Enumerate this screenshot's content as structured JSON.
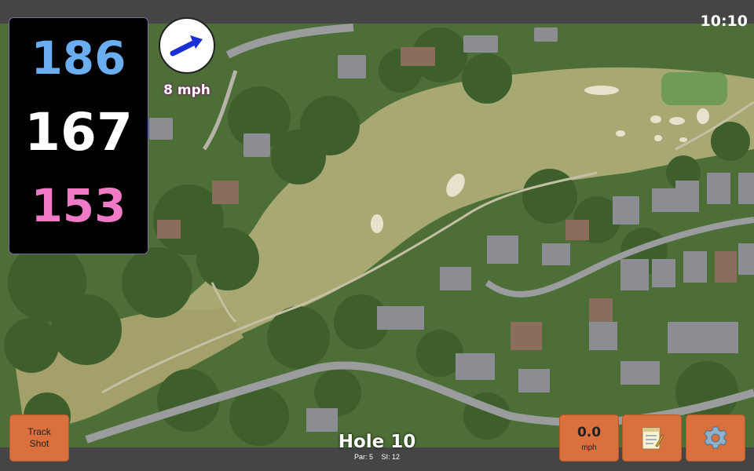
{
  "status_bar": {
    "time": "10:10"
  },
  "distances": {
    "back": "186",
    "center": "167",
    "front": "153"
  },
  "wind": {
    "speed_label": "8 mph",
    "direction_icon": "arrow-icon"
  },
  "hole": {
    "title": "Hole 10",
    "par_label": "Par: 5",
    "si_label": "SI: 12"
  },
  "buttons": {
    "track_shot": "Track\nShot",
    "speed_value": "0.0",
    "speed_unit": "mph",
    "notes_icon": "notepad-icon",
    "settings_icon": "gear-icon"
  },
  "colors": {
    "back": "#6aaef0",
    "center": "#ffffff",
    "front": "#f07ac6",
    "button": "#d9703e",
    "wind_text_glow": "#7a1a6a"
  }
}
